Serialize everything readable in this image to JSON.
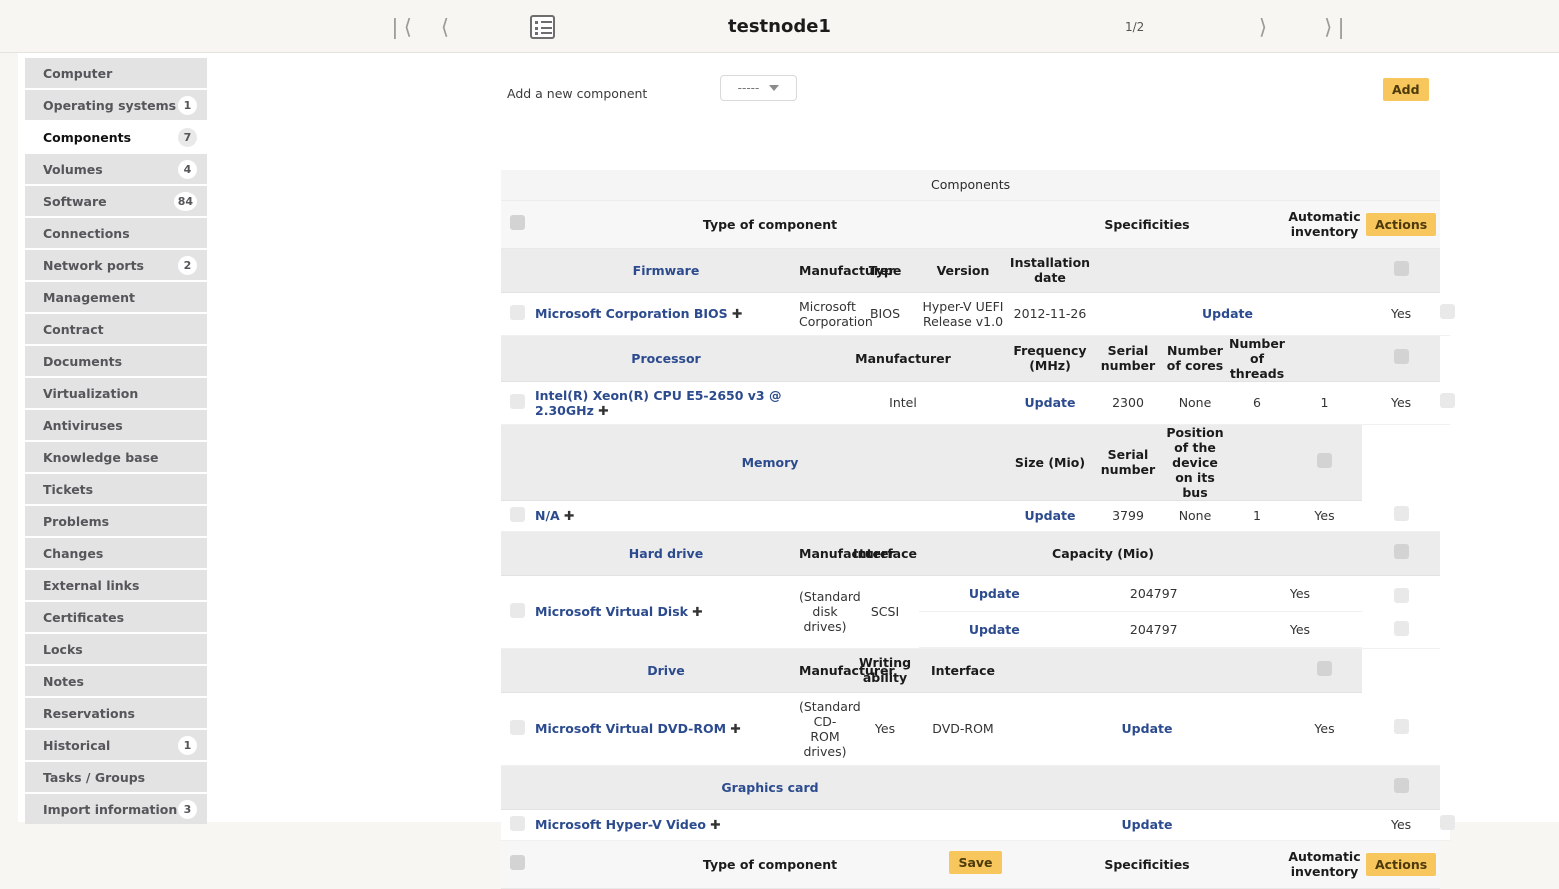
{
  "topbar": {
    "title": "testnode1",
    "counter": "1/2",
    "first_label": "❘⟨",
    "prev_label": "⟨",
    "next_label": "⟩",
    "last_label": "⟩❘",
    "list_icon": "list-icon"
  },
  "sidebar": {
    "items": [
      {
        "label": "Computer",
        "badge": "",
        "active": false
      },
      {
        "label": "Operating systems",
        "badge": "1",
        "active": false
      },
      {
        "label": "Components",
        "badge": "7",
        "active": true
      },
      {
        "label": "Volumes",
        "badge": "4",
        "active": false
      },
      {
        "label": "Software",
        "badge": "84",
        "active": false
      },
      {
        "label": "Connections",
        "badge": "",
        "active": false
      },
      {
        "label": "Network ports",
        "badge": "2",
        "active": false
      },
      {
        "label": "Management",
        "badge": "",
        "active": false
      },
      {
        "label": "Contract",
        "badge": "",
        "active": false
      },
      {
        "label": "Documents",
        "badge": "",
        "active": false
      },
      {
        "label": "Virtualization",
        "badge": "",
        "active": false
      },
      {
        "label": "Antiviruses",
        "badge": "",
        "active": false
      },
      {
        "label": "Knowledge base",
        "badge": "",
        "active": false
      },
      {
        "label": "Tickets",
        "badge": "",
        "active": false
      },
      {
        "label": "Problems",
        "badge": "",
        "active": false
      },
      {
        "label": "Changes",
        "badge": "",
        "active": false
      },
      {
        "label": "External links",
        "badge": "",
        "active": false
      },
      {
        "label": "Certificates",
        "badge": "",
        "active": false
      },
      {
        "label": "Locks",
        "badge": "",
        "active": false
      },
      {
        "label": "Notes",
        "badge": "",
        "active": false
      },
      {
        "label": "Reservations",
        "badge": "",
        "active": false
      },
      {
        "label": "Historical",
        "badge": "1",
        "active": false
      },
      {
        "label": "Tasks / Groups",
        "badge": "",
        "active": false
      },
      {
        "label": "Import information",
        "badge": "3",
        "active": false
      }
    ]
  },
  "add_component": {
    "label": "Add a new component",
    "select_value": "-----",
    "add_button": "Add"
  },
  "table": {
    "caption": "Components",
    "header": {
      "type_of_component": "Type of component",
      "specificities": "Specificities",
      "automatic_inventory": "Automatic inventory",
      "actions": "Actions"
    },
    "sections": [
      {
        "name": "Firmware",
        "columns": [
          "Firmware",
          "Manufacturer",
          "Type",
          "Version",
          "Installation date"
        ],
        "rows": [
          {
            "name": "Microsoft Corporation BIOS",
            "cells": [
              "Microsoft Corporation",
              "BIOS",
              "Hyper-V UEFI Release v1.0",
              "2012-11-26"
            ],
            "update": "Update",
            "auto": "Yes"
          }
        ]
      },
      {
        "name": "Processor",
        "columns": [
          "Processor",
          "Manufacturer",
          "Frequency (MHz)",
          "Serial number",
          "Number of cores",
          "Number of threads"
        ],
        "rows": [
          {
            "name": "Intel(R) Xeon(R) CPU E5-2650 v3 @ 2.30GHz",
            "cells": [
              "Intel"
            ],
            "update": "Update",
            "metrics": [
              "2300",
              "None",
              "6",
              "1"
            ],
            "auto": "Yes"
          }
        ]
      },
      {
        "name": "Memory",
        "columns": [
          "Memory",
          "Size (Mio)",
          "Serial number",
          "Position of the device on its bus"
        ],
        "rows": [
          {
            "name": "N/A",
            "update": "Update",
            "metrics": [
              "3799",
              "None",
              "1"
            ],
            "auto": "Yes"
          }
        ]
      },
      {
        "name": "Hard drive",
        "columns": [
          "Hard drive",
          "Manufacturer",
          "Interface",
          "Capacity (Mio)"
        ],
        "rows": [
          {
            "name": "Microsoft Virtual Disk",
            "cells": [
              "(Standard disk drives)",
              "SCSI"
            ],
            "sub_rows": [
              {
                "update": "Update",
                "capacity": "204797",
                "auto": "Yes"
              },
              {
                "update": "Update",
                "capacity": "204797",
                "auto": "Yes"
              }
            ]
          }
        ]
      },
      {
        "name": "Drive",
        "columns": [
          "Drive",
          "Manufacturer",
          "Writing ability",
          "Interface"
        ],
        "rows": [
          {
            "name": "Microsoft Virtual DVD-ROM",
            "cells": [
              "(Standard CD-ROM drives)",
              "Yes",
              "DVD-ROM"
            ],
            "update": "Update",
            "auto": "Yes"
          }
        ]
      },
      {
        "name": "Graphics card",
        "columns": [
          "Graphics card"
        ],
        "rows": [
          {
            "name": "Microsoft Hyper-V Video",
            "update": "Update",
            "auto": "Yes"
          }
        ]
      }
    ]
  },
  "footer": {
    "save_label": "Save"
  },
  "colors": {
    "accent": "#f7c65c",
    "link": "#2c4b8e",
    "sidebar_item_bg": "#e3e3e3",
    "page_bg": "#f7f6f2"
  }
}
